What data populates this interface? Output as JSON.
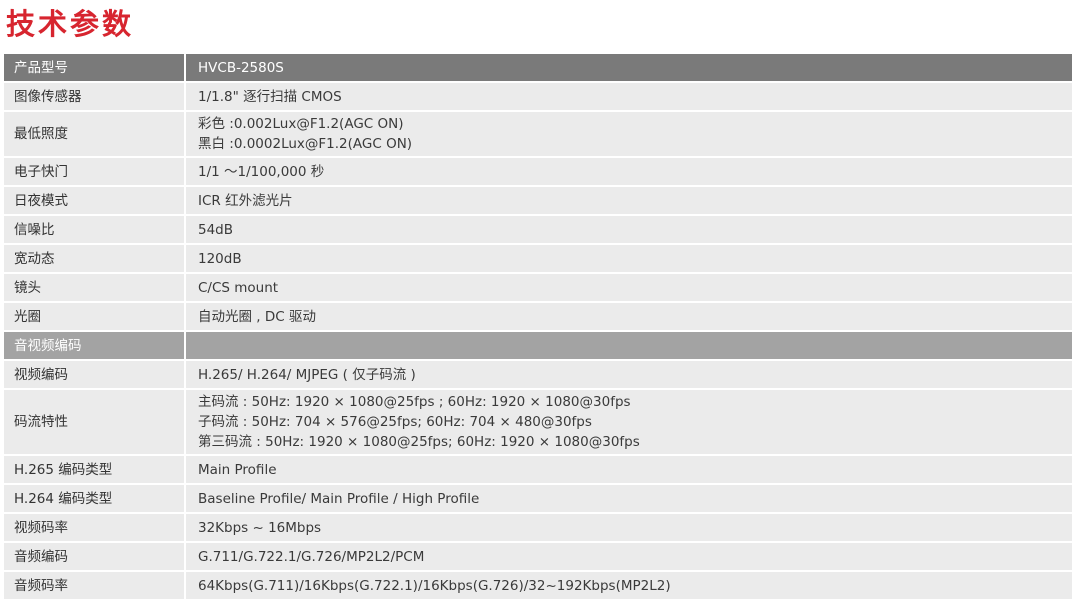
{
  "title": "技术参数",
  "header": {
    "label": "产品型号",
    "value": "HVCB-2580S"
  },
  "rows_camera": [
    {
      "label": "图像传感器",
      "lines": [
        "1/1.8\" 逐行扫描 CMOS"
      ]
    },
    {
      "label": "最低照度",
      "lines": [
        "彩色 :0.002Lux@F1.2(AGC ON)",
        "黑白 :0.0002Lux@F1.2(AGC ON)"
      ]
    },
    {
      "label": "电子快门",
      "lines": [
        "1/1 ～1/100,000 秒"
      ]
    },
    {
      "label": "日夜模式",
      "lines": [
        "ICR 红外滤光片"
      ]
    },
    {
      "label": "信噪比",
      "lines": [
        "54dB"
      ]
    },
    {
      "label": "宽动态",
      "lines": [
        "120dB"
      ]
    },
    {
      "label": "镜头",
      "lines": [
        "C/CS mount"
      ]
    },
    {
      "label": "光圈",
      "lines": [
        "自动光圈 , DC 驱动"
      ]
    }
  ],
  "section_av": {
    "label": "音视频编码"
  },
  "rows_av": [
    {
      "label": "视频编码",
      "lines": [
        "H.265/ H.264/ MJPEG ( 仅子码流 )"
      ]
    },
    {
      "label": "码流特性",
      "faint": true,
      "lines": [
        "主码流 : 50Hz: 1920 × 1080@25fps ; 60Hz: 1920 × 1080@30fps",
        "子码流 : 50Hz: 704 × 576@25fps; 60Hz: 704 × 480@30fps",
        "第三码流 : 50Hz: 1920 × 1080@25fps; 60Hz: 1920 × 1080@30fps"
      ]
    },
    {
      "label": "H.265 编码类型",
      "lines": [
        "Main Profile"
      ]
    },
    {
      "label": "H.264 编码类型",
      "lines": [
        "Baseline Profile/ Main Profile / High Profile"
      ]
    },
    {
      "label": "视频码率",
      "lines": [
        "32Kbps ~ 16Mbps"
      ]
    },
    {
      "label": "音频编码",
      "lines": [
        "G.711/G.722.1/G.726/MP2L2/PCM"
      ]
    },
    {
      "label": "音频码率",
      "lines": [
        "64Kbps(G.711)/16Kbps(G.722.1)/16Kbps(G.726)/32~192Kbps(MP2L2)"
      ]
    }
  ]
}
